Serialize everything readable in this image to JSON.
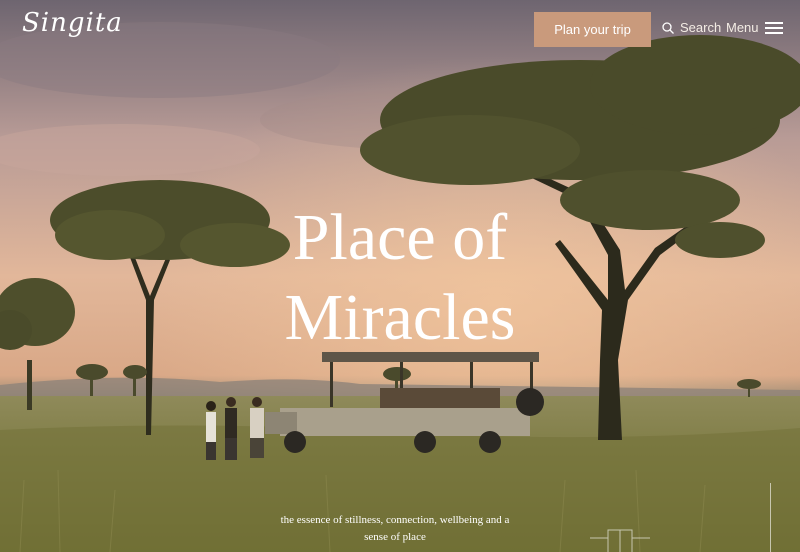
{
  "header": {
    "logo": "Singita",
    "plan_button": "Plan your trip",
    "search_label": "Search",
    "menu_label": "Menu"
  },
  "hero": {
    "headline_line1": "Place of",
    "headline_line2": "Miracles",
    "tagline": "the essence of stillness, connection, wellbeing and a sense of place"
  },
  "colors": {
    "accent": "#c99a7c",
    "text": "#ffffff"
  },
  "icons": {
    "search": "search-icon",
    "menu": "hamburger-icon"
  }
}
